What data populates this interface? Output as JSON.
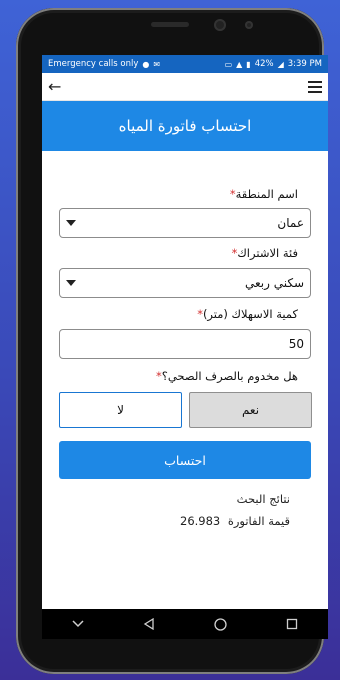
{
  "status_bar": {
    "carrier_text": "Emergency calls only",
    "battery": "42%",
    "time": "3:39 PM"
  },
  "app_bar": {
    "title": "احتساب فاتورة المياه"
  },
  "form": {
    "region": {
      "label": "اسم المنطقة",
      "required_mark": "*",
      "value": "عمان"
    },
    "category": {
      "label": "فئة الاشتراك",
      "required_mark": "*",
      "value": "سكني ربعي"
    },
    "consumption": {
      "label": "كمية الاسهلاك (متر)",
      "required_mark": "*",
      "value": "50"
    },
    "sanitation": {
      "label": "هل مخدوم بالصرف الصحي؟",
      "required_mark": "*",
      "yes_label": "نعم",
      "no_label": "لا",
      "selected": "نعم"
    },
    "submit_label": "احتساب"
  },
  "results": {
    "title": "نتائج البحث",
    "bill_label": "قيمة الفاتورة",
    "bill_value": "26.983"
  },
  "colors": {
    "primary": "#1e88e5",
    "status_bar": "#1565c0",
    "required": "#d32f2f"
  }
}
